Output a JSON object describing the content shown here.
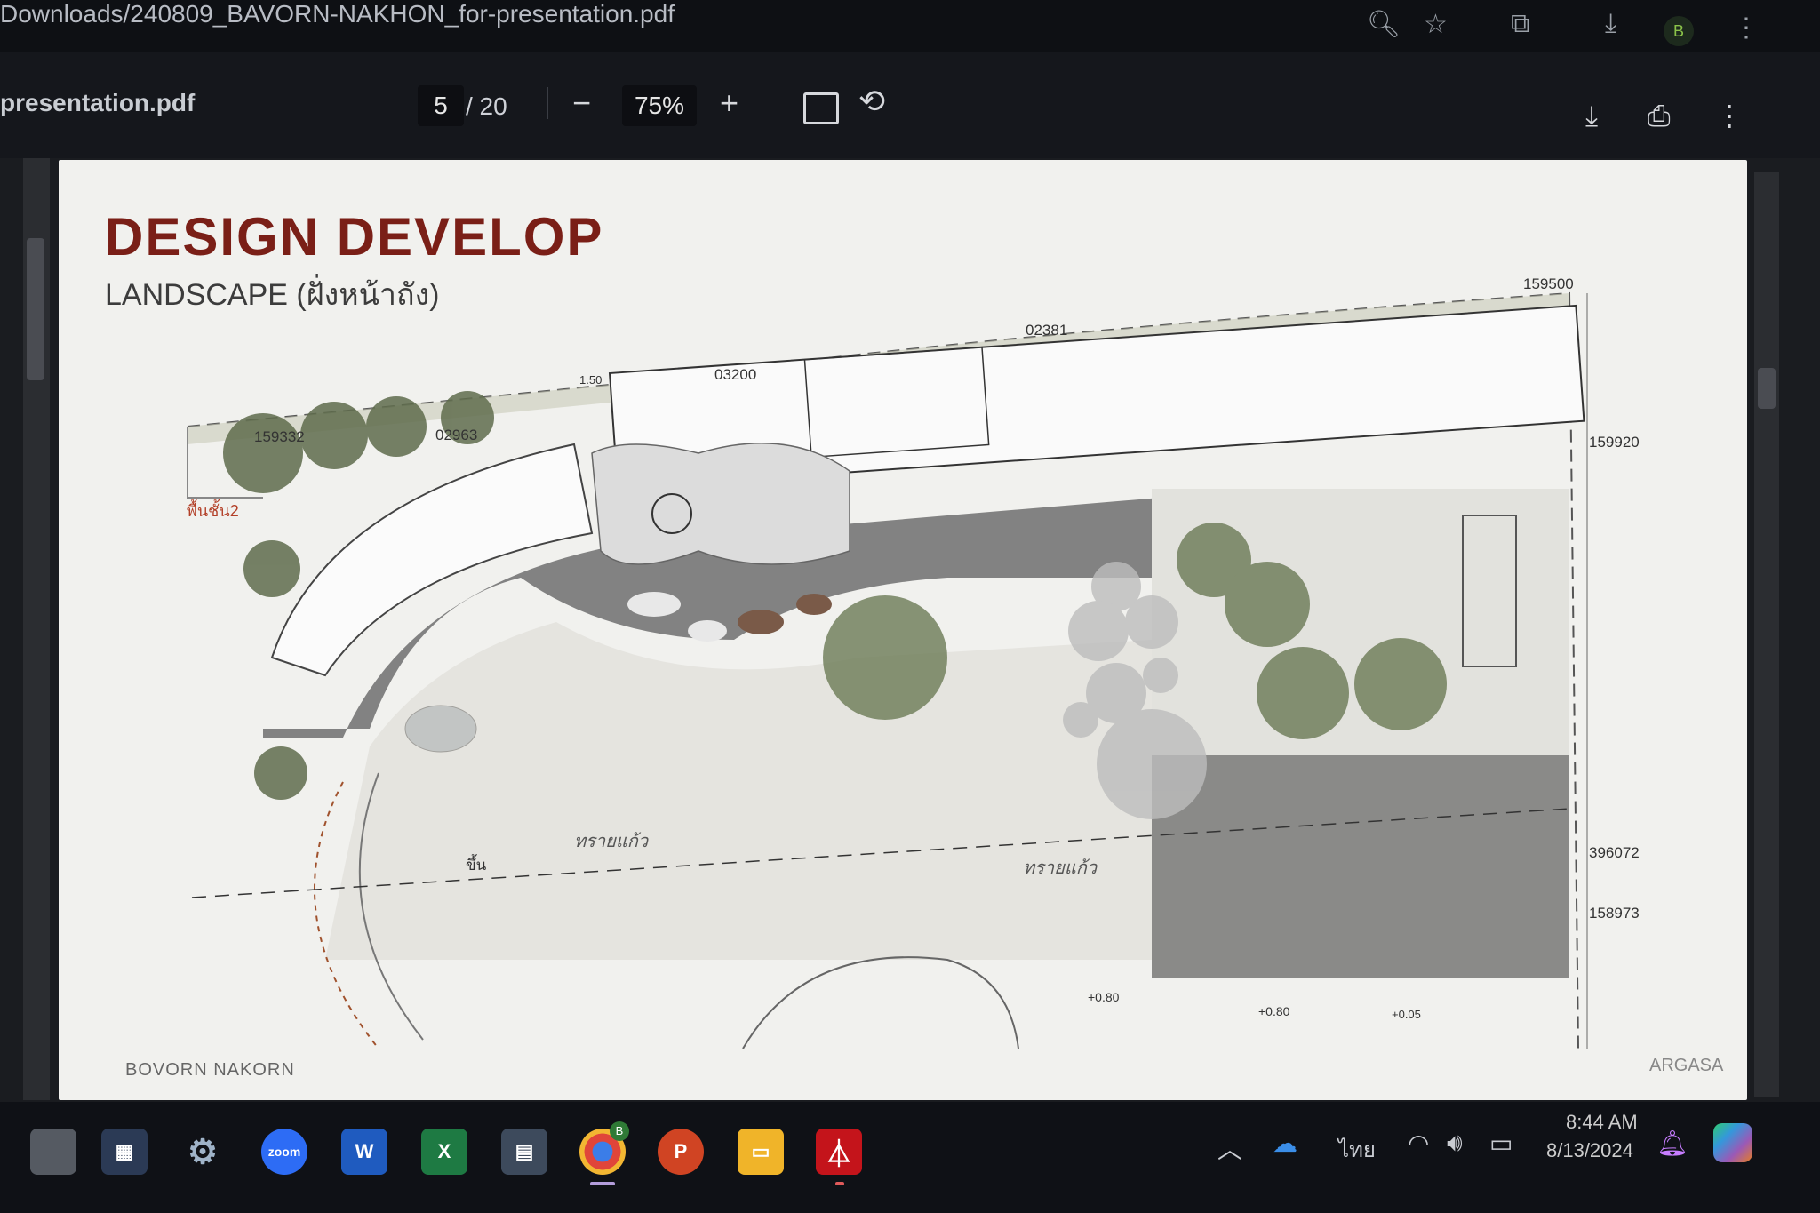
{
  "browser": {
    "title": "Downloads/240809_BAVORN-NAKHON_for-presentation.pdf",
    "avatar_letter": "B"
  },
  "pdf_toolbar": {
    "filename": "presentation.pdf",
    "page_current": "5",
    "page_total": "/ 20",
    "zoom": "75%",
    "zoom_out": "−",
    "zoom_in": "+"
  },
  "document": {
    "title": "DESIGN  DEVELOP",
    "subtitle": "LANDSCAPE (ฝั่งหน้าถัง)",
    "footer_left": "BOVORN NAKORN",
    "footer_right": "ARGASA",
    "labels": {
      "d1": "159332",
      "d2": "02963",
      "d3": "1.50",
      "d4": "03200",
      "d5": "02381",
      "d6": "159500",
      "d7": "159920",
      "d8": "396072",
      "d9": "158973",
      "d10": "+0.80",
      "d11": "+0.80",
      "d12": "+0.05",
      "floor2": "พื้นชั้น2",
      "sand1": "ทรายแก้ว",
      "sand2": "ทรายแก้ว",
      "up": "ขึ้น"
    }
  },
  "taskbar": {
    "apps": [
      "file-explorer-app",
      "store-app",
      "settings-app",
      "zoom-app",
      "word-app",
      "excel-app",
      "calculator-app",
      "chrome-app",
      "powerpoint-app",
      "files-app",
      "acrobat-app"
    ],
    "zoom_label": "zoom",
    "word_label": "W",
    "excel_label": "X",
    "ppt_label": "P",
    "chrome_badge": "B",
    "language": "ไทย",
    "time": "8:44 AM",
    "date": "8/13/2024"
  },
  "colors": {
    "title_red": "#7a1f17",
    "paving_dark": "#6e6e6e",
    "tree_green": "#6b7a55"
  }
}
